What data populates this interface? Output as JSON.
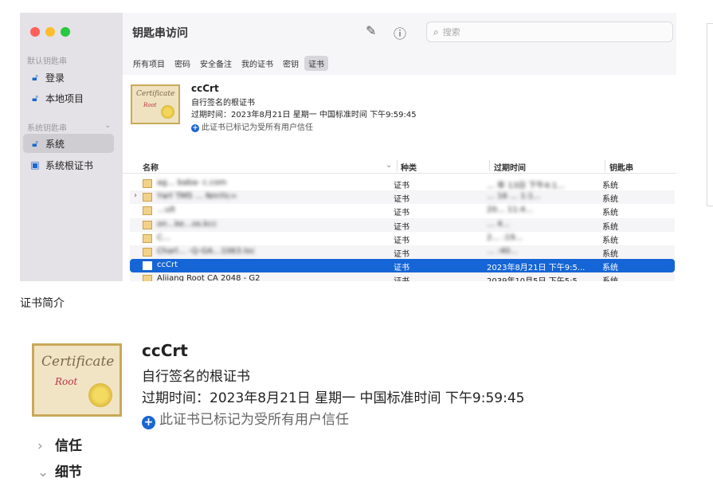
{
  "window": {
    "title": "钥匙串访问",
    "search_placeholder": "搜索",
    "traffic_lights": [
      "#ff5f57",
      "#febc2e",
      "#28c840"
    ]
  },
  "sidebar": {
    "section_default": "默认钥匙串",
    "default_items": [
      {
        "label": "登录",
        "icon": "lock-open-icon"
      },
      {
        "label": "本地项目",
        "icon": "lock-open-icon"
      }
    ],
    "section_system": "系统钥匙串",
    "system_items": [
      {
        "label": "系统",
        "icon": "lock-open-icon",
        "selected": true
      },
      {
        "label": "系统根证书",
        "icon": "cabinet-icon"
      }
    ]
  },
  "tabs": [
    "所有项目",
    "密码",
    "安全备注",
    "我的证书",
    "密钥",
    "证书"
  ],
  "selected_tab": "证书",
  "summary": {
    "name": "ccCrt",
    "type": "自行签名的根证书",
    "expiry": "过期时间：2023年8月21日 星期一 中国标准时间 下午9:59:45",
    "trust": "此证书已标记为受所有用户信任",
    "cert_text": "Certificate",
    "cert_sub": "Root"
  },
  "table": {
    "columns": [
      "名称",
      "种类",
      "过期时间",
      "钥匙串"
    ],
    "rows": [
      {
        "name": "ag…  baba- c.com",
        "kind": "证书",
        "expires": "… 年 13日 下午4:1...",
        "keychain": "系统",
        "blurred": true
      },
      {
        "name": "YwY  TM5 …  NmYic=",
        "kind": "证书",
        "expires": "… 16 … 1:1...",
        "keychain": "系统",
        "blurred": true,
        "expandable": true
      },
      {
        "name": "…ult",
        "kind": "证书",
        "expires": "20… 11:4...",
        "keychain": "系统",
        "blurred": true
      },
      {
        "name": "on…ke…os.kcc",
        "kind": "证书",
        "expires": "… 4...",
        "keychain": "系统",
        "blurred": true
      },
      {
        "name": "C…",
        "kind": "证书",
        "expires": "2… :19...",
        "keychain": "系统",
        "blurred": true
      },
      {
        "name": "Charl… -Q-GA…1063.loc",
        "kind": "证书",
        "expires": "… :40...",
        "keychain": "系统",
        "blurred": true
      },
      {
        "name": "ccCrt",
        "kind": "证书",
        "expires": "2023年8月21日 下午9:5...",
        "keychain": "系统",
        "selected": true
      },
      {
        "name": "Aliiang Root CA 2048 - G2",
        "kind": "证书",
        "expires": "2039年10月5日 下午5:5...",
        "keychain": "系统"
      }
    ]
  },
  "caption": "证书简介",
  "detail": {
    "name": "ccCrt",
    "type": "自行签名的根证书",
    "expiry": "过期时间：2023年8月21日 星期一 中国标准时间 下午9:59:45",
    "trust": "此证书已标记为受所有用户信任",
    "cert_text": "Certificate",
    "cert_sub": "Root",
    "sections": [
      {
        "label": "信任",
        "expanded": false
      },
      {
        "label": "细节",
        "expanded": true
      }
    ]
  }
}
